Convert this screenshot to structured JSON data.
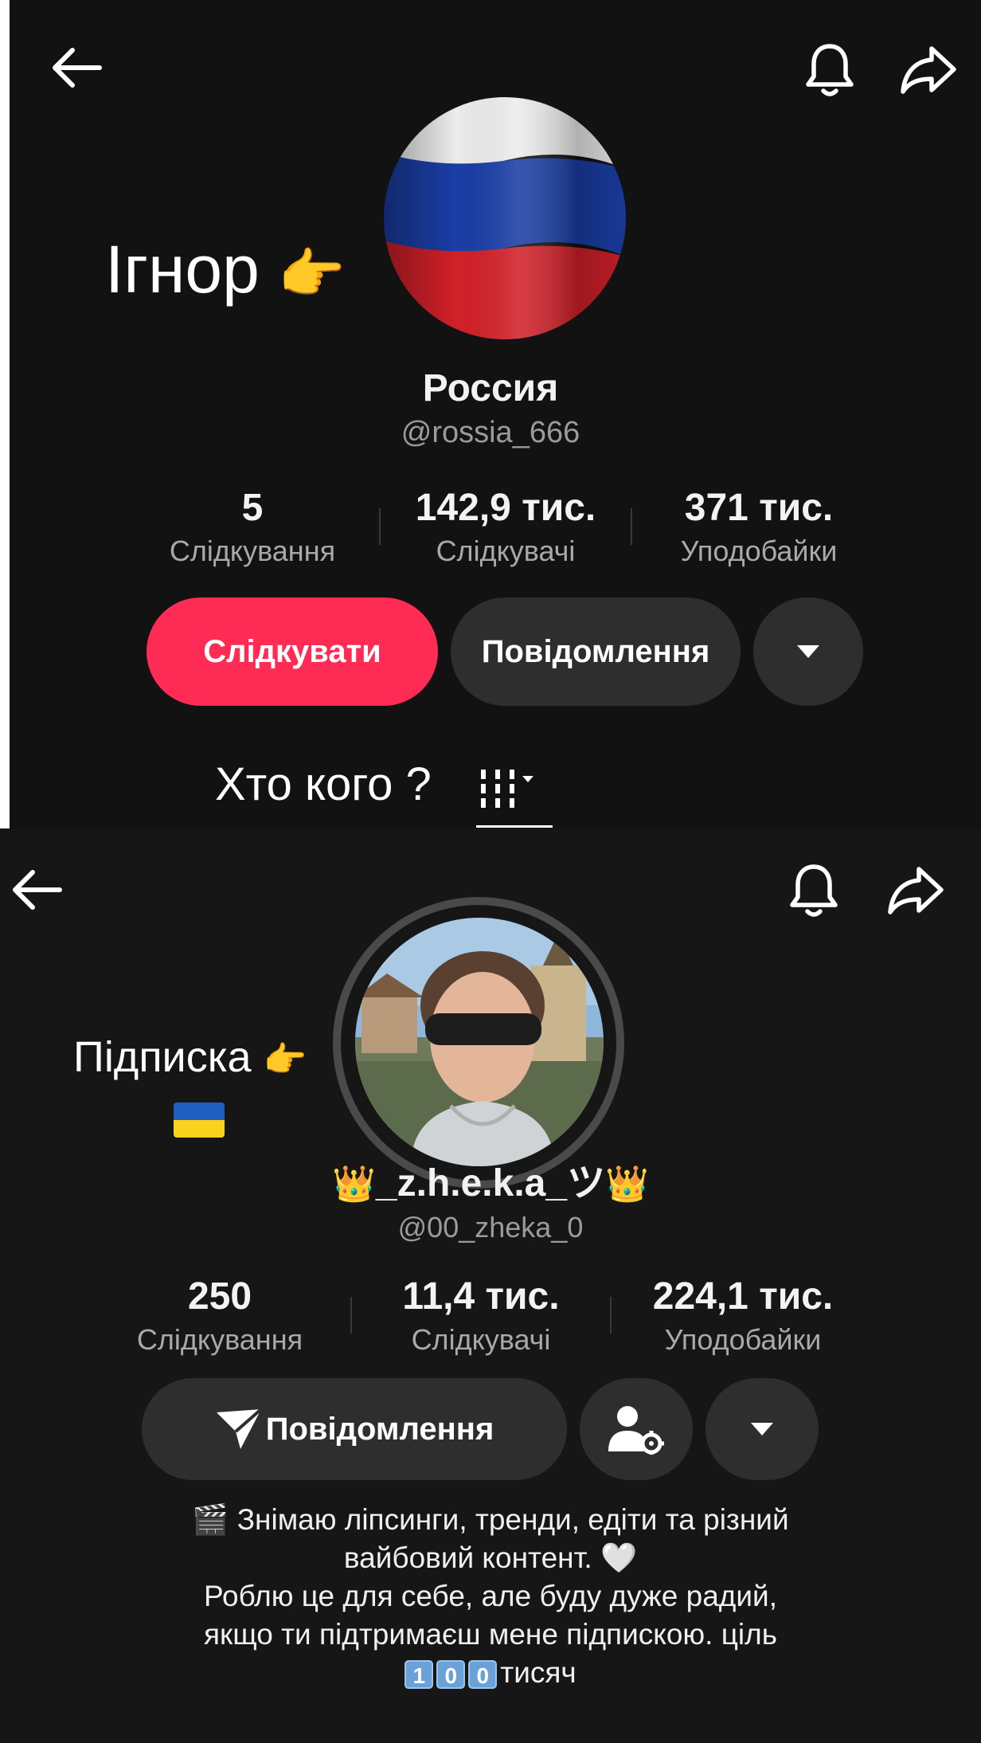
{
  "top_profile": {
    "overlay_label": "Ігнор",
    "name": "Россия",
    "handle": "@rossia_666",
    "stats": [
      {
        "value": "5",
        "label": "Слідкування"
      },
      {
        "value": "142,9 тис.",
        "label": "Слідкувачі"
      },
      {
        "value": "371 тис.",
        "label": "Уподобайки"
      }
    ],
    "follow_label": "Слідкувати",
    "message_label": "Повідомлення",
    "flag_colors": [
      "#ffffff",
      "#1c3fa8",
      "#d4202a"
    ]
  },
  "middle_caption": {
    "text": "Хто кого ?"
  },
  "bottom_profile": {
    "overlay_label": "Підписка",
    "name": "_z.h.e.k.a_ツ",
    "handle": "@00_zheka_0",
    "stats": [
      {
        "value": "250",
        "label": "Слідкування"
      },
      {
        "value": "11,4 тис.",
        "label": "Слідкувачі"
      },
      {
        "value": "224,1 тис.",
        "label": "Уподобайки"
      }
    ],
    "message_label": "Повідомлення",
    "bio_lines": [
      "Знімаю ліпсинги, тренди, едіти та різний",
      "вайбовий контент.",
      "Роблю це для себе, але буду дуже радий,",
      "якщо ти підтримаєш мене підпискою. ціль"
    ],
    "goal_digits": [
      "1",
      "0",
      "0"
    ],
    "goal_suffix": "тисяч"
  },
  "icons": {
    "back": "arrow-left-icon",
    "bell": "bell-icon",
    "share": "share-icon",
    "dropdown": "caret-down-icon",
    "send": "send-icon",
    "person_settings": "person-gear-icon",
    "pointing_hand": "pointing-right-emoji",
    "ukraine_flag": "ukraine-flag-emoji",
    "crown": "crown-emoji",
    "clapper": "clapper-emoji",
    "heart": "white-heart-emoji"
  },
  "colors": {
    "accent": "#fe2c55",
    "button_dark": "#2e2e2e",
    "ukraine_blue": "#1f5fbf",
    "ukraine_yellow": "#f8d21b"
  }
}
